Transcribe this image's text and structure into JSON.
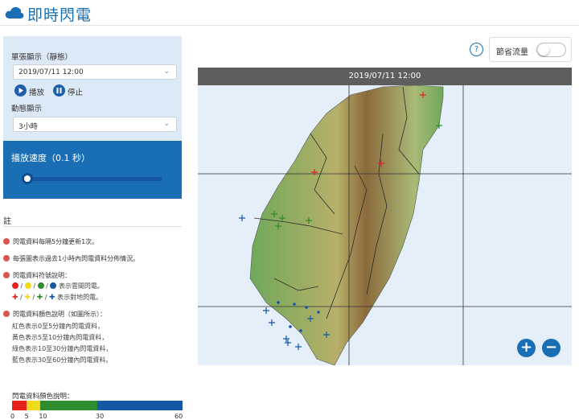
{
  "app": {
    "title": "即時閃電",
    "logo_icon": "cloud-icon"
  },
  "controls": {
    "single_label": "單張顯示（靜態）",
    "single_date": "2019/07/11 12:00",
    "play_label": "播放",
    "stop_label": "停止",
    "dynamic_label": "動態顯示",
    "dynamic_range": "3小時",
    "speed_title": "播放速度（0.1 秒）",
    "speed_value": 0.1
  },
  "notes": {
    "title": "註",
    "items": [
      "閃電資料每隔5分鐘更新1次。",
      "每張圖表示過去1小時內閃電資料分佈情況。",
      "閃電資料符號說明：",
      "閃電資料顏色說明（如圖所示）："
    ],
    "symbol_cloud_text": "表示雲間閃電。",
    "symbol_ground_text": "表示對地閃電。",
    "color_lines": [
      "紅色表示0至5分鐘內閃電資料，",
      "黃色表示5至10分鐘內閃電資料，",
      "綠色表示10至30分鐘內閃電資料，",
      "藍色表示30至60分鐘內閃電資料。"
    ],
    "separator": "/"
  },
  "scale": {
    "title": "閃電資料顏色說明：",
    "ticks": [
      "0",
      "5",
      "10",
      "30",
      "60"
    ],
    "colors": [
      "#e8221b",
      "#f2d81b",
      "#2e8b2e",
      "#1557a6"
    ],
    "bounds": [
      0,
      5,
      10,
      30,
      60
    ]
  },
  "top_right": {
    "help_symbol": "?",
    "save_label": "節省流量",
    "save_enabled": false
  },
  "map": {
    "timestamp": "2019/07/11 12:00",
    "zoom_in": "+",
    "zoom_out": "−"
  }
}
